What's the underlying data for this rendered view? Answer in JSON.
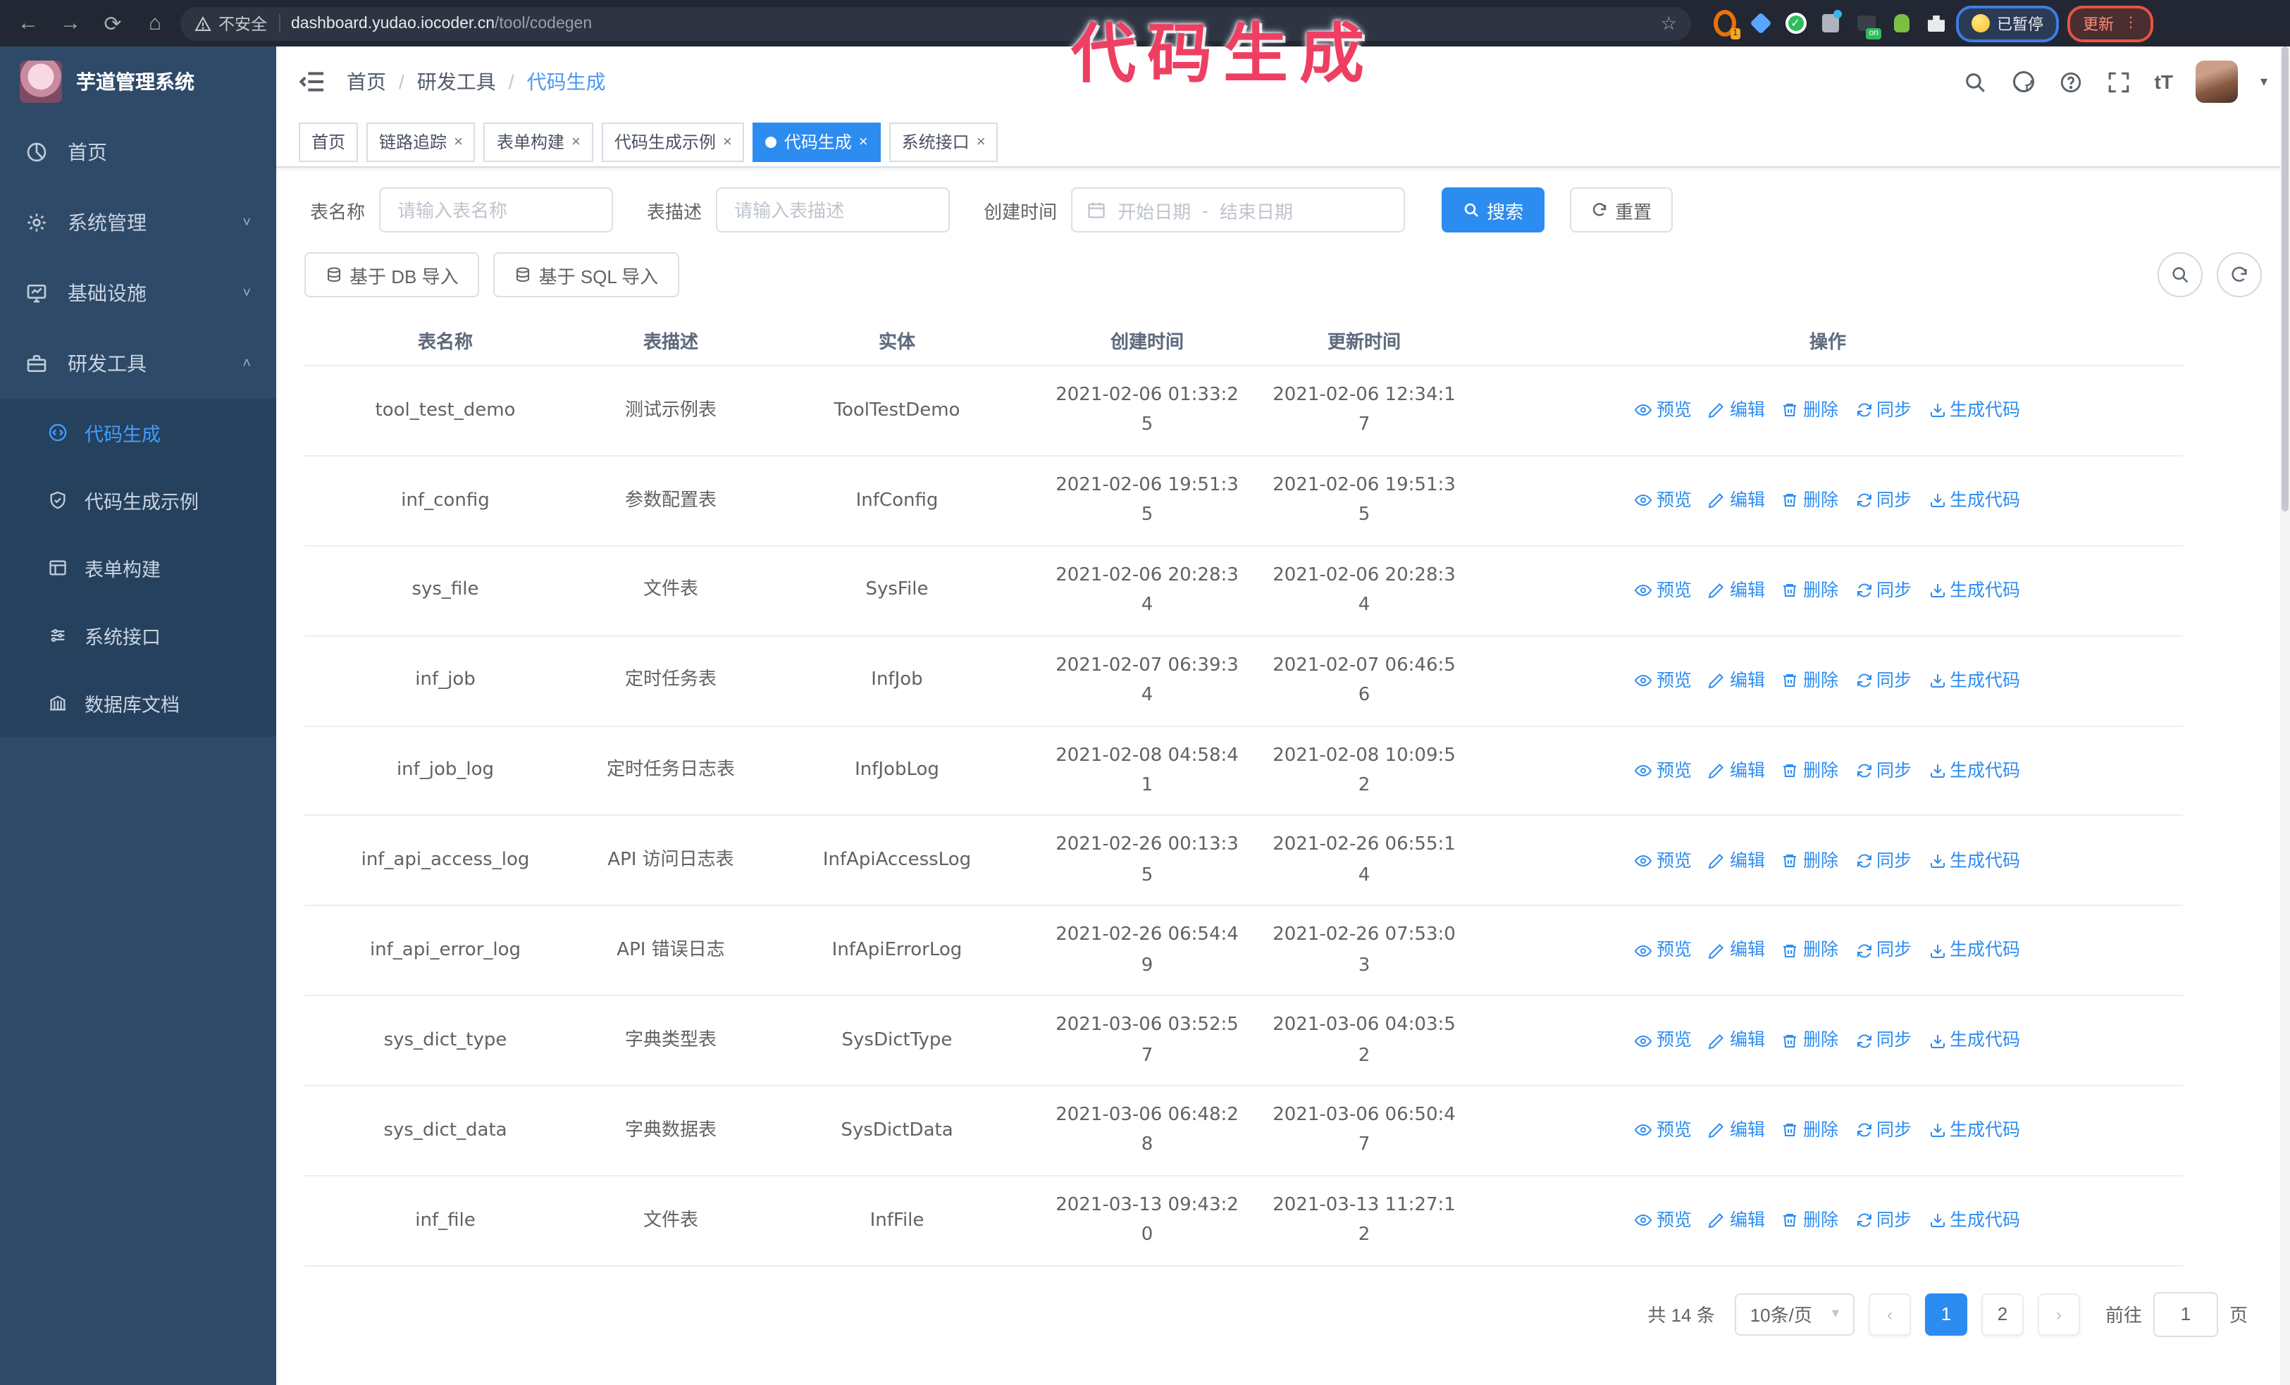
{
  "browser": {
    "security_label": "不安全",
    "url_host": "dashboard.yudao.iocoder.cn",
    "url_path": "/tool/codegen",
    "extension_badge_1": "1",
    "extension_badge_on": "on",
    "paused_badge": "已暂停",
    "update_button": "更新"
  },
  "annotation": {
    "text": "代码生成",
    "color": "#ee3f63"
  },
  "sidebar": {
    "app_title": "芋道管理系统",
    "items": [
      {
        "label": "首页",
        "expandable": false
      },
      {
        "label": "系统管理",
        "expandable": true,
        "state": "collapsed"
      },
      {
        "label": "基础设施",
        "expandable": true,
        "state": "collapsed"
      },
      {
        "label": "研发工具",
        "expandable": true,
        "state": "expanded"
      }
    ],
    "subitems": [
      {
        "label": "代码生成",
        "active": true
      },
      {
        "label": "代码生成示例",
        "active": false
      },
      {
        "label": "表单构建",
        "active": false
      },
      {
        "label": "系统接口",
        "active": false
      },
      {
        "label": "数据库文档",
        "active": false
      }
    ]
  },
  "header": {
    "breadcrumb": [
      "首页",
      "研发工具",
      "代码生成"
    ]
  },
  "tabs": [
    {
      "label": "首页",
      "closable": false,
      "active": false
    },
    {
      "label": "链路追踪",
      "closable": true,
      "active": false
    },
    {
      "label": "表单构建",
      "closable": true,
      "active": false
    },
    {
      "label": "代码生成示例",
      "closable": true,
      "active": false
    },
    {
      "label": "代码生成",
      "closable": true,
      "active": true
    },
    {
      "label": "系统接口",
      "closable": true,
      "active": false
    }
  ],
  "filters": {
    "table_name_label": "表名称",
    "table_name_placeholder": "请输入表名称",
    "table_desc_label": "表描述",
    "table_desc_placeholder": "请输入表描述",
    "create_time_label": "创建时间",
    "date_start_placeholder": "开始日期",
    "date_separator": "-",
    "date_end_placeholder": "结束日期",
    "search_label": "搜索",
    "reset_label": "重置"
  },
  "toolbar": {
    "import_db_label": "基于 DB 导入",
    "import_sql_label": "基于 SQL 导入"
  },
  "table": {
    "columns": [
      "表名称",
      "表描述",
      "实体",
      "创建时间",
      "更新时间",
      "操作"
    ],
    "actions": [
      "预览",
      "编辑",
      "删除",
      "同步",
      "生成代码"
    ],
    "rows": [
      {
        "name": "tool_test_demo",
        "desc": "测试示例表",
        "entity": "ToolTestDemo",
        "create_time": "2021-02-06 01:33:25",
        "update_time": "2021-02-06 12:34:17"
      },
      {
        "name": "inf_config",
        "desc": "参数配置表",
        "entity": "InfConfig",
        "create_time": "2021-02-06 19:51:35",
        "update_time": "2021-02-06 19:51:35"
      },
      {
        "name": "sys_file",
        "desc": "文件表",
        "entity": "SysFile",
        "create_time": "2021-02-06 20:28:34",
        "update_time": "2021-02-06 20:28:34"
      },
      {
        "name": "inf_job",
        "desc": "定时任务表",
        "entity": "InfJob",
        "create_time": "2021-02-07 06:39:34",
        "update_time": "2021-02-07 06:46:56"
      },
      {
        "name": "inf_job_log",
        "desc": "定时任务日志表",
        "entity": "InfJobLog",
        "create_time": "2021-02-08 04:58:41",
        "update_time": "2021-02-08 10:09:52"
      },
      {
        "name": "inf_api_access_log",
        "desc": "API 访问日志表",
        "entity": "InfApiAccessLog",
        "create_time": "2021-02-26 00:13:35",
        "update_time": "2021-02-26 06:55:14"
      },
      {
        "name": "inf_api_error_log",
        "desc": "API 错误日志",
        "entity": "InfApiErrorLog",
        "create_time": "2021-02-26 06:54:49",
        "update_time": "2021-02-26 07:53:03"
      },
      {
        "name": "sys_dict_type",
        "desc": "字典类型表",
        "entity": "SysDictType",
        "create_time": "2021-03-06 03:52:57",
        "update_time": "2021-03-06 04:03:52"
      },
      {
        "name": "sys_dict_data",
        "desc": "字典数据表",
        "entity": "SysDictData",
        "create_time": "2021-03-06 06:48:28",
        "update_time": "2021-03-06 06:50:47"
      },
      {
        "name": "inf_file",
        "desc": "文件表",
        "entity": "InfFile",
        "create_time": "2021-03-13 09:43:20",
        "update_time": "2021-03-13 11:27:12"
      }
    ]
  },
  "pagination": {
    "total_text": "共 14 条",
    "page_size": "10条/页",
    "pages": [
      "1",
      "2"
    ],
    "active_page": "1",
    "goto_label": "前往",
    "goto_value": "1",
    "page_unit": "页"
  }
}
